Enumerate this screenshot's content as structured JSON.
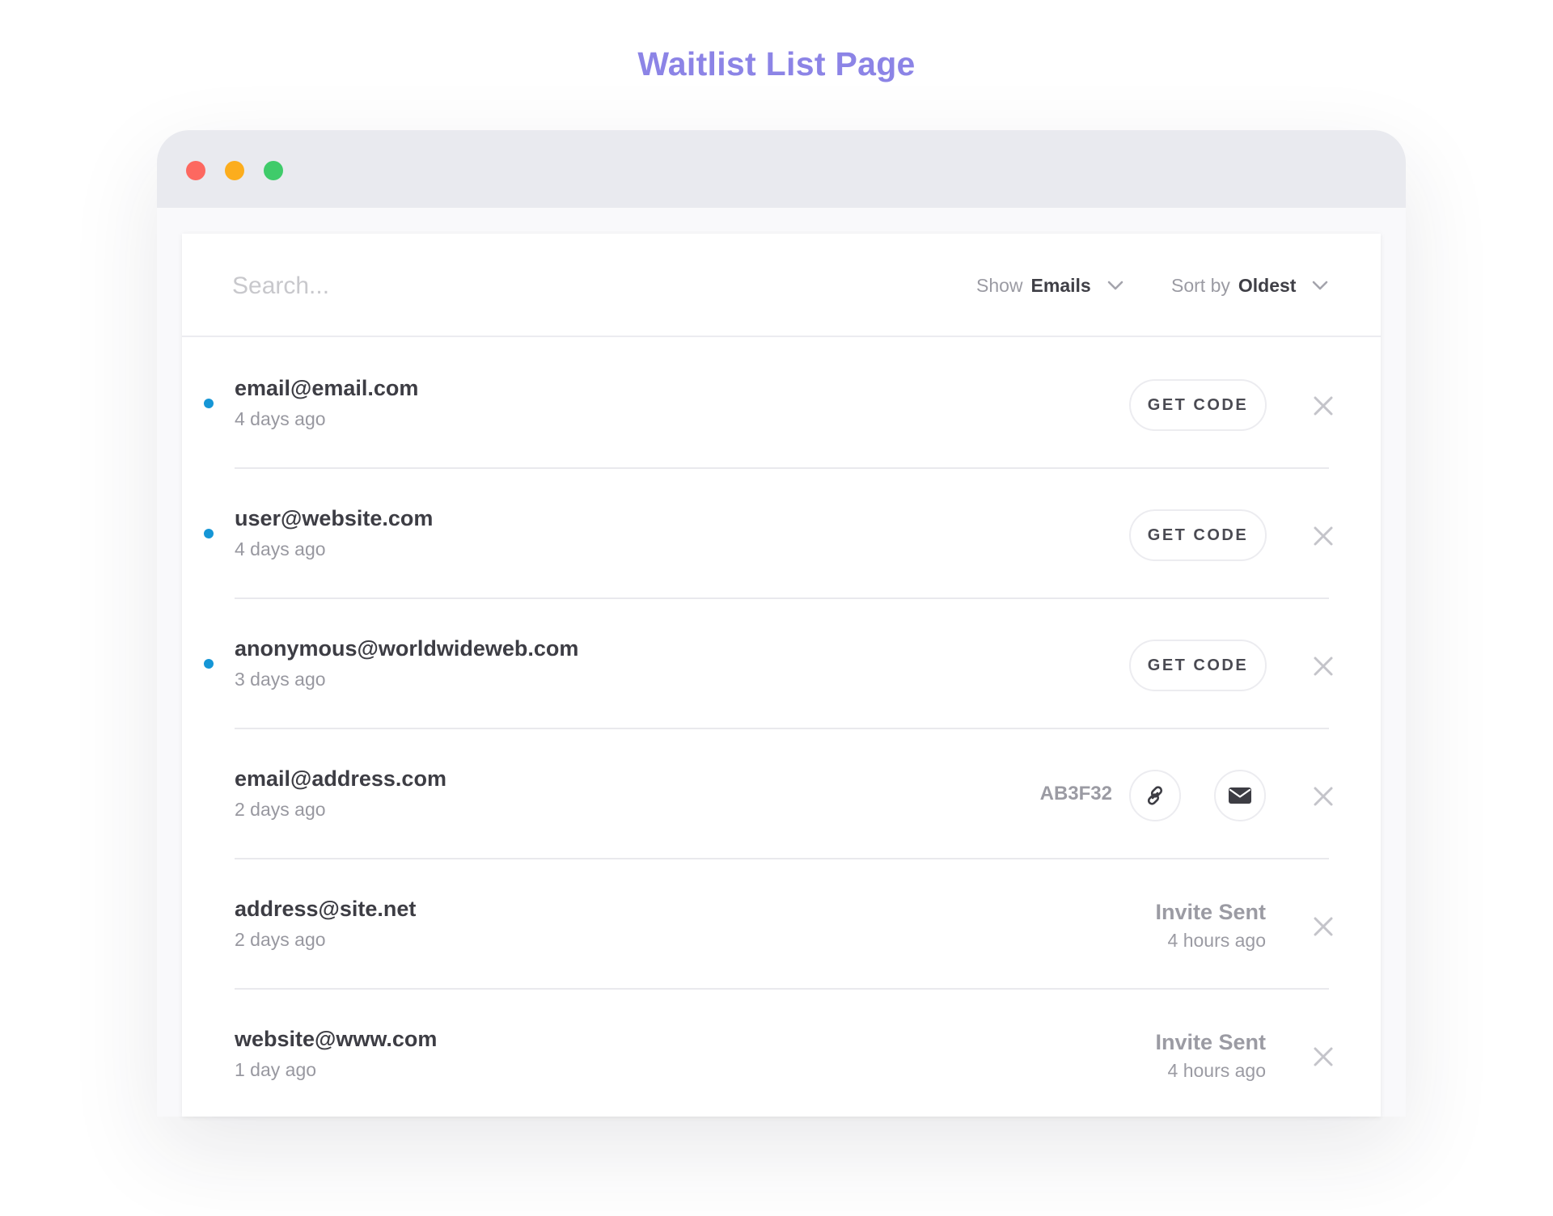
{
  "page_title": "Waitlist List Page",
  "window_controls": [
    {
      "name": "close",
      "color": "#fd6860"
    },
    {
      "name": "minimize",
      "color": "#fcad1d"
    },
    {
      "name": "maximize",
      "color": "#3fcb6a"
    }
  ],
  "toolbar": {
    "search_placeholder": "Search...",
    "show_label": "Show",
    "show_value": "Emails",
    "sort_label": "Sort by",
    "sort_value": "Oldest"
  },
  "colors": {
    "accent": "#8c84e6",
    "unread_dot": "#1596d6"
  },
  "rows": [
    {
      "email": "email@email.com",
      "age": "4 days ago",
      "unread": true,
      "state": "pending",
      "action_label": "GET CODE"
    },
    {
      "email": "user@website.com",
      "age": "4 days ago",
      "unread": true,
      "state": "pending",
      "action_label": "GET CODE"
    },
    {
      "email": "anonymous@worldwideweb.com",
      "age": "3 days ago",
      "unread": true,
      "state": "pending",
      "action_label": "GET CODE"
    },
    {
      "email": "email@address.com",
      "age": "2 days ago",
      "unread": false,
      "state": "code",
      "code": "AB3F32",
      "icons": [
        "link-icon",
        "mail-icon"
      ]
    },
    {
      "email": "address@site.net",
      "age": "2 days ago",
      "unread": false,
      "state": "sent",
      "status": "Invite Sent",
      "status_time": "4 hours ago"
    },
    {
      "email": "website@www.com",
      "age": "1 day ago",
      "unread": false,
      "state": "sent",
      "status": "Invite Sent",
      "status_time": "4 hours ago"
    }
  ]
}
